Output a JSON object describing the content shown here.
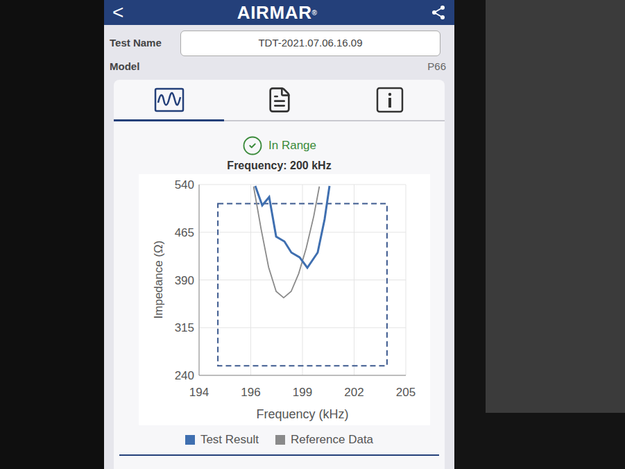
{
  "header": {
    "back": "<",
    "logo": "AIRMAR",
    "logo_mark": "®"
  },
  "test_name": {
    "label": "Test Name",
    "value": "TDT-2021.07.06.16.09"
  },
  "model": {
    "label": "Model",
    "value": "P66"
  },
  "tabs": [
    {
      "kind": "chart",
      "selected": true
    },
    {
      "kind": "document",
      "selected": false
    },
    {
      "kind": "info",
      "selected": false
    }
  ],
  "status": {
    "text": "In Range",
    "in_range": true
  },
  "chart": {
    "title": "Frequency: 200 kHz",
    "y_axis": {
      "title": "Impedance (Ω)",
      "min": 240,
      "max": 540,
      "ticks": [
        "540",
        "465",
        "390",
        "315",
        "240"
      ]
    },
    "x_axis": {
      "title": "Frequency (kHz)",
      "min": 194,
      "max": 205,
      "ticks": [
        "194",
        "196",
        "199",
        "202",
        "205"
      ]
    },
    "limits": {
      "freq_min": 195,
      "freq_max": 204,
      "impedance_min": 255,
      "impedance_max": 510
    },
    "series": [
      {
        "name": "Test Result",
        "color": "#3f6fb0",
        "frequencies": [
          196.99,
          197.36,
          197.73,
          198.1,
          198.54,
          198.91,
          199.35,
          199.76,
          200.31,
          200.68,
          200.94
        ],
        "values": [
          537.8,
          507.3,
          520.4,
          458.2,
          450.5,
          433.1,
          425.5,
          409.1,
          433.1,
          485.5,
          537.8
        ]
      },
      {
        "name": "Reference Data",
        "color": "#8a8a8a",
        "frequencies": [
          196.9,
          197.3,
          197.7,
          198.1,
          198.5,
          198.9,
          199.3,
          199.7,
          200.1,
          200.4
        ],
        "values": [
          537,
          470,
          410,
          372,
          362,
          372,
          400,
          440,
          490,
          537
        ]
      }
    ]
  }
}
